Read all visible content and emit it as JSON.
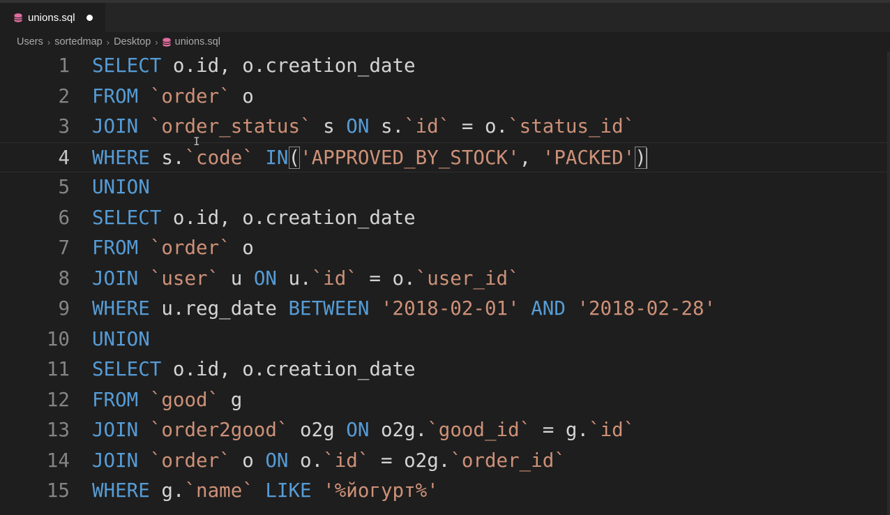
{
  "tab": {
    "filename": "unions.sql",
    "icon": "database-icon",
    "dirty": true
  },
  "breadcrumb": [
    "Users",
    "sortedmap",
    "Desktop",
    "unions.sql"
  ],
  "editor": {
    "current_line": 4,
    "line_numbers": [
      "1",
      "2",
      "3",
      "4",
      "5",
      "6",
      "7",
      "8",
      "9",
      "10",
      "11",
      "12",
      "13",
      "14",
      "15"
    ],
    "lines": [
      [
        [
          "kw",
          "SELECT"
        ],
        [
          "id",
          " o.id, o.creation_date"
        ]
      ],
      [
        [
          "kw",
          "FROM"
        ],
        [
          "id",
          " "
        ],
        [
          "bt",
          "`order`"
        ],
        [
          "id",
          " o"
        ]
      ],
      [
        [
          "kw",
          "JOIN"
        ],
        [
          "id",
          " "
        ],
        [
          "bt",
          "`order_status`"
        ],
        [
          "id",
          " s "
        ],
        [
          "kw",
          "ON"
        ],
        [
          "id",
          " s."
        ],
        [
          "bt",
          "`id`"
        ],
        [
          "op",
          " = "
        ],
        [
          "id",
          "o."
        ],
        [
          "bt",
          "`status_id`"
        ]
      ],
      [
        [
          "kw",
          "WHERE"
        ],
        [
          "id",
          " s."
        ],
        [
          "bt",
          "`code`"
        ],
        [
          "id",
          " "
        ],
        [
          "kw",
          "IN"
        ],
        [
          "match",
          "("
        ],
        [
          "str",
          "'APPROVED_BY_STOCK'"
        ],
        [
          "id",
          ", "
        ],
        [
          "str",
          "'PACKED'"
        ],
        [
          "match",
          ")"
        ]
      ],
      [
        [
          "kw",
          "UNION"
        ]
      ],
      [
        [
          "kw",
          "SELECT"
        ],
        [
          "id",
          " o.id, o.creation_date"
        ]
      ],
      [
        [
          "kw",
          "FROM"
        ],
        [
          "id",
          " "
        ],
        [
          "bt",
          "`order`"
        ],
        [
          "id",
          " o"
        ]
      ],
      [
        [
          "kw",
          "JOIN"
        ],
        [
          "id",
          " "
        ],
        [
          "bt",
          "`user`"
        ],
        [
          "id",
          " u "
        ],
        [
          "kw",
          "ON"
        ],
        [
          "id",
          " u."
        ],
        [
          "bt",
          "`id`"
        ],
        [
          "op",
          " = "
        ],
        [
          "id",
          "o."
        ],
        [
          "bt",
          "`user_id`"
        ]
      ],
      [
        [
          "kw",
          "WHERE"
        ],
        [
          "id",
          " u.reg_date "
        ],
        [
          "kw",
          "BETWEEN"
        ],
        [
          "id",
          " "
        ],
        [
          "str",
          "'2018-02-01'"
        ],
        [
          "id",
          " "
        ],
        [
          "kw",
          "AND"
        ],
        [
          "id",
          " "
        ],
        [
          "str",
          "'2018-02-28'"
        ]
      ],
      [
        [
          "kw",
          "UNION"
        ]
      ],
      [
        [
          "kw",
          "SELECT"
        ],
        [
          "id",
          " o.id, o.creation_date"
        ]
      ],
      [
        [
          "kw",
          "FROM"
        ],
        [
          "id",
          " "
        ],
        [
          "bt",
          "`good`"
        ],
        [
          "id",
          " g"
        ]
      ],
      [
        [
          "kw",
          "JOIN"
        ],
        [
          "id",
          " "
        ],
        [
          "bt",
          "`order2good`"
        ],
        [
          "id",
          " o2g "
        ],
        [
          "kw",
          "ON"
        ],
        [
          "id",
          " o2g."
        ],
        [
          "bt",
          "`good_id`"
        ],
        [
          "op",
          " = "
        ],
        [
          "id",
          "g."
        ],
        [
          "bt",
          "`id`"
        ]
      ],
      [
        [
          "kw",
          "JOIN"
        ],
        [
          "id",
          " "
        ],
        [
          "bt",
          "`order`"
        ],
        [
          "id",
          " o "
        ],
        [
          "kw",
          "ON"
        ],
        [
          "id",
          " o."
        ],
        [
          "bt",
          "`id`"
        ],
        [
          "op",
          " = "
        ],
        [
          "id",
          "o2g."
        ],
        [
          "bt",
          "`order_id`"
        ]
      ],
      [
        [
          "kw",
          "WHERE"
        ],
        [
          "id",
          " g."
        ],
        [
          "bt",
          "`name`"
        ],
        [
          "id",
          " "
        ],
        [
          "kw",
          "LIKE"
        ],
        [
          "id",
          " "
        ],
        [
          "str",
          "'%йогурт%'"
        ]
      ]
    ]
  },
  "colors": {
    "keyword": "#569cd6",
    "string": "#ce9178",
    "identifier": "#d4d4d4",
    "line_number": "#858585",
    "background": "#1e1e1e",
    "db_icon": "#e06c9f"
  }
}
